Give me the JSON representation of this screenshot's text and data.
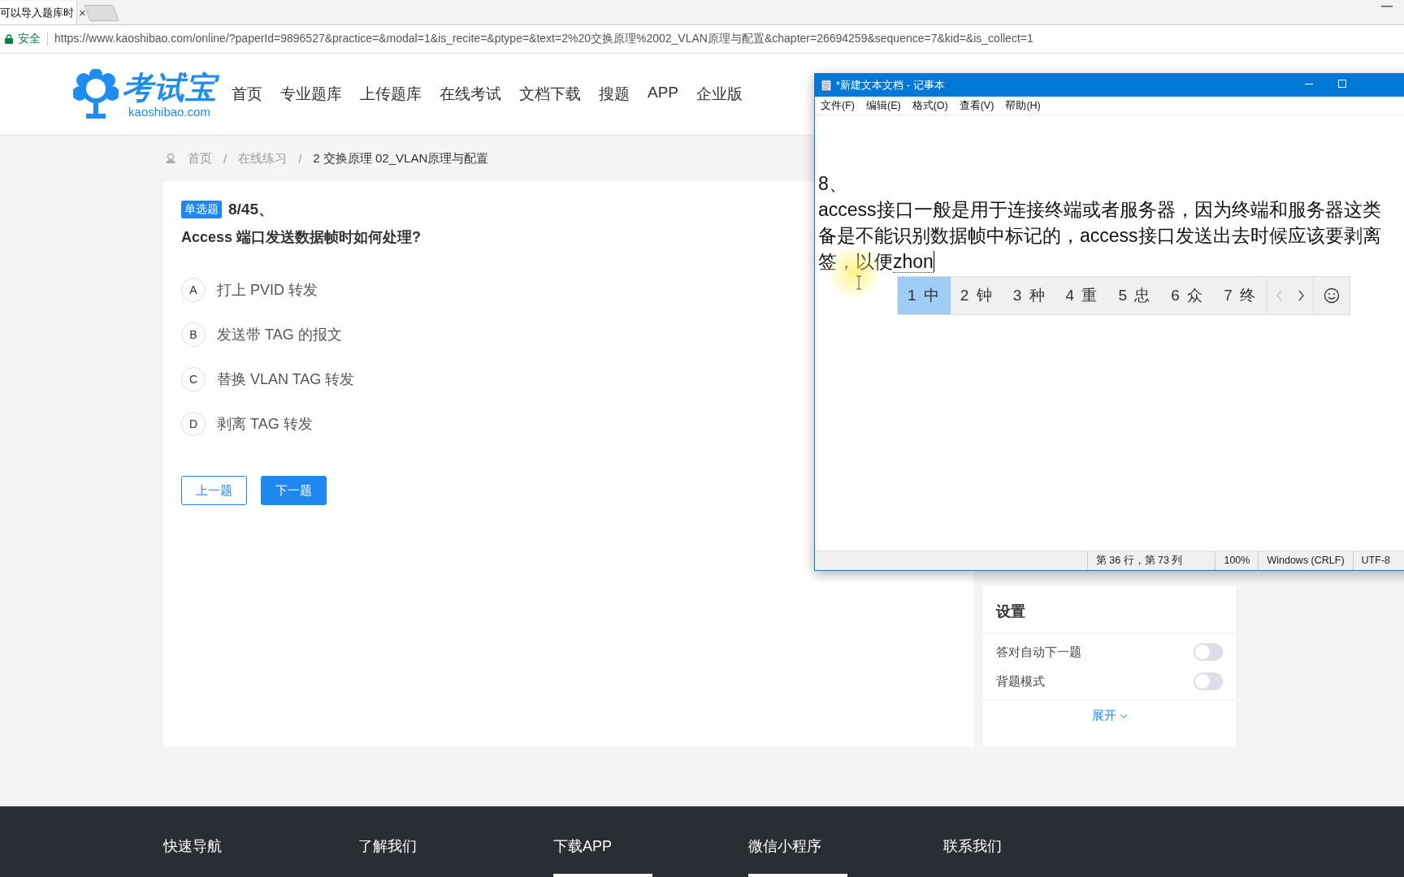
{
  "browser": {
    "tab": {
      "title": "可以导入题库时",
      "close": "×"
    },
    "address_bar": {
      "security": "安全",
      "url": "https://www.kaoshibao.com/online/?paperId=9896527&practice=&modal=1&is_recite=&ptype=&text=2%20交换原理%2002_VLAN原理与配置&chapter=26694259&sequence=7&kid=&is_collect=1"
    }
  },
  "site_header": {
    "logo": {
      "name": "考试宝",
      "domain": "kaoshibao.com"
    },
    "nav": [
      {
        "label": "首页"
      },
      {
        "label": "专业题库"
      },
      {
        "label": "上传题库"
      },
      {
        "label": "在线考试"
      },
      {
        "label": "文档下载"
      },
      {
        "label": "搜题"
      },
      {
        "label": "APP"
      },
      {
        "label": "企业版"
      }
    ]
  },
  "breadcrumb": {
    "separator": "/",
    "items": [
      "首页",
      "在线练习",
      "2 交换原理 02_VLAN原理与配置"
    ]
  },
  "question": {
    "type_tag": "单选题",
    "number": "8/45、",
    "text": "Access 端口发送数据帧时如何处理?",
    "options": [
      {
        "letter": "A",
        "text": "打上 PVID 转发",
        "selected": false
      },
      {
        "letter": "B",
        "text": "发送带 TAG 的报文",
        "selected": false
      },
      {
        "letter": "C",
        "text": "替换 VLAN TAG 转发",
        "selected": false
      },
      {
        "letter": "D",
        "text": "剥离 TAG 转发",
        "selected": false
      }
    ],
    "buttons": [
      {
        "label": "上一题",
        "kind": "outline"
      },
      {
        "label": "下一题",
        "kind": "primary"
      }
    ]
  },
  "settings": {
    "title": "设置",
    "toggles": [
      {
        "label": "答对自动下一题",
        "on": false
      },
      {
        "label": "背题模式",
        "on": false
      }
    ],
    "expand": "展开"
  },
  "footer": {
    "columns": [
      {
        "title": "快速导航",
        "image": false
      },
      {
        "title": "了解我们",
        "image": false
      },
      {
        "title": "下载APP",
        "image": true
      },
      {
        "title": "微信小程序",
        "image": true
      },
      {
        "title": "联系我们",
        "image": false
      }
    ]
  },
  "notepad": {
    "title": "*新建文本文档 - 记事本",
    "menu": [
      "文件(F)",
      "编辑(E)",
      "格式(O)",
      "查看(V)",
      "帮助(H)"
    ],
    "lines": [
      "8、",
      "access接口一般是用于连接终端或者服务器，因为终端和服务器这类",
      "备是不能识别数据帧中标记的，access接口发送出去时候应该要剥离",
      "签，以便"
    ],
    "composition": "zhon",
    "ime": {
      "candidates": [
        {
          "label": "1 中",
          "selected": true
        },
        {
          "label": "2 钟",
          "selected": false
        },
        {
          "label": "3 种",
          "selected": false
        },
        {
          "label": "4 重",
          "selected": false
        },
        {
          "label": "5 忠",
          "selected": false
        },
        {
          "label": "6 众",
          "selected": false
        },
        {
          "label": "7 终",
          "selected": false
        }
      ],
      "paging": [
        {
          "kind": "prev",
          "disabled": true
        },
        {
          "kind": "next",
          "disabled": false
        }
      ]
    },
    "status": [
      "第 36 行，第 73 列",
      "100%",
      "Windows (CRLF)",
      "UTF-8"
    ]
  }
}
